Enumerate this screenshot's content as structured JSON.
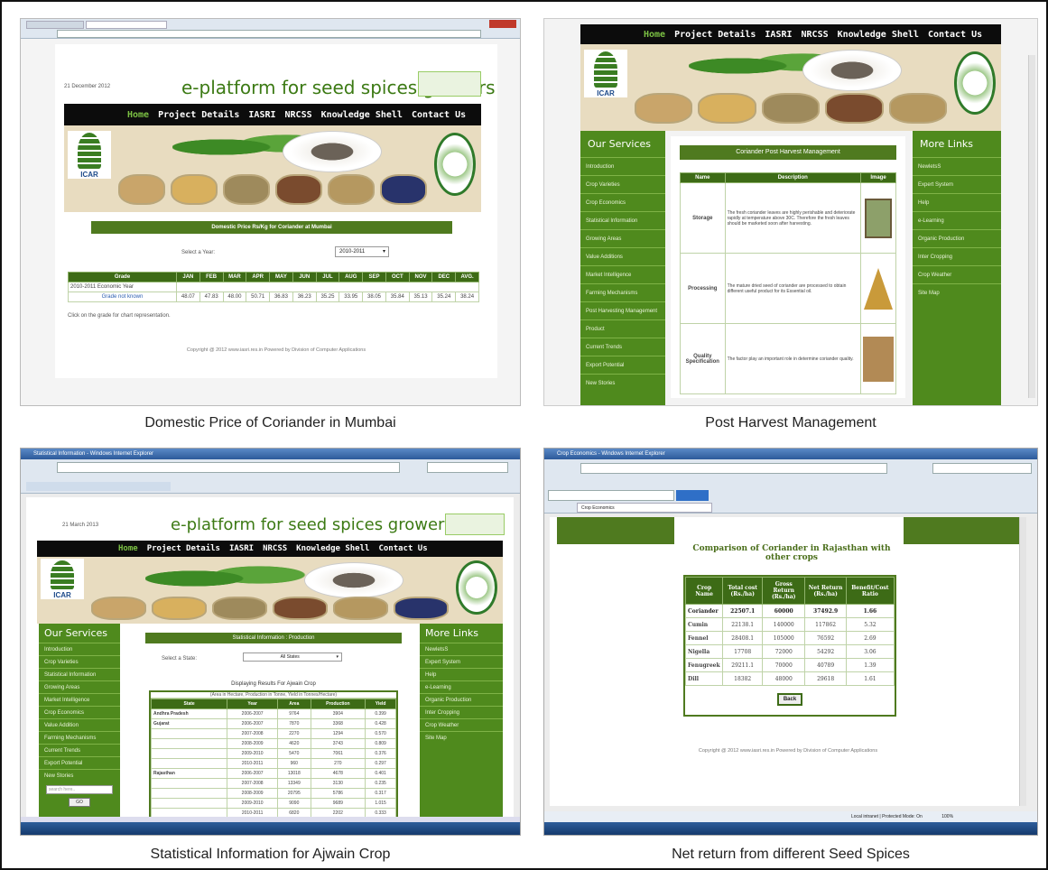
{
  "captions": {
    "q1": "Domestic Price of Coriander in Mumbai",
    "q2": "Post Harvest Management",
    "q3": "Statistical Information for Ajwain Crop",
    "q4": "Net return from different Seed Spices"
  },
  "site": {
    "title": "e-platform for seed spices growers",
    "nav": [
      "Home",
      "Project Details",
      "IASRI",
      "NRCSS",
      "Knowledge Shell",
      "Contact Us"
    ],
    "icar_logo_text": "ICAR",
    "copyright": "Copyright @ 2012 www.iasri.res.in Powered by Division of Computer Applications"
  },
  "q1": {
    "date": "21 December 2012",
    "price_heading": "Domestic Price Rs/Kg for Coriander at Mumbai",
    "select_label": "Select a Year:",
    "select_value": "2010-2011",
    "table_headers": [
      "Grade",
      "JAN",
      "FEB",
      "MAR",
      "APR",
      "MAY",
      "JUN",
      "JUL",
      "AUG",
      "SEP",
      "OCT",
      "NOV",
      "DEC",
      "AVG."
    ],
    "row_year": "2010-2011 Economic Year",
    "row_grade": "Grade not known",
    "row_values": [
      "48.07",
      "47.83",
      "48.00",
      "50.71",
      "36.83",
      "36.23",
      "35.25",
      "33.95",
      "38.05",
      "35.84",
      "35.13",
      "35.24",
      "38.24"
    ],
    "note": "Click on the grade for chart representation."
  },
  "q2": {
    "services_head": "Our Services",
    "services": [
      "Introduction",
      "Crop Varieties",
      "Crop Economics",
      "Statistical Information",
      "Growing Areas",
      "Value Additions",
      "Market Intelligence",
      "Farming Mechanisms",
      "Post Harvesting Management",
      "Product",
      "Current Trends",
      "Export Potential",
      "New Stories"
    ],
    "links_head": "More Links",
    "links": [
      "NewletsS",
      "Expert System",
      "Help",
      "e-Learning",
      "Organic Production",
      "Inter Cropping",
      "Crop Weather",
      "Site Map"
    ],
    "heading": "Coriander Post Harvest Management",
    "cols": [
      "Name",
      "Description",
      "Image"
    ],
    "rows": [
      {
        "name": "Storage",
        "desc": "The fresh coriander leaves are highly perishable and deteriorate rapidly at temperature above 30C. Therefore the fresh leaves should be marketed soon after harvesting."
      },
      {
        "name": "Processing",
        "desc": "The mature dried seed of coriander are processed to obtain different useful product for its Essential oil."
      },
      {
        "name": "Quality Specification",
        "desc": "The factor play an important role in determine coriander quality."
      }
    ]
  },
  "q3": {
    "window_title": "Statistical Information - Windows Internet Explorer",
    "date": "21 March 2013",
    "services_head": "Our Services",
    "services": [
      "Introduction",
      "Crop Varieties",
      "Statistical Information",
      "Growing Areas",
      "Market Intelligence",
      "Crop Economics",
      "Value Addition",
      "Farming Mechanisms",
      "Current Trends",
      "Export Potential",
      "New Stories"
    ],
    "links_head": "More Links",
    "links": [
      "NewletsS",
      "Expert System",
      "Help",
      "e-Learning",
      "Organic Production",
      "Inter Cropping",
      "Crop Weather",
      "Site Map"
    ],
    "heading": "Statistical Information : Production",
    "select_label": "Select a State:",
    "select_value": "All States",
    "results_title": "Displaying Results For Ajwain Crop",
    "units": "(Area in Hectare, Production in Tonne, Yield in Tonnes/Hectare)",
    "cols": [
      "State",
      "Year",
      "Area",
      "Production",
      "Yield"
    ],
    "rows": [
      [
        "Andhra Pradesh",
        "2006-2007",
        "9764",
        "3904",
        "0.399"
      ],
      [
        "Gujarat",
        "2006-2007",
        "7870",
        "3368",
        "0.428"
      ],
      [
        "",
        "2007-2008",
        "2270",
        "1294",
        "0.570"
      ],
      [
        "",
        "2008-2009",
        "4620",
        "3743",
        "0.809"
      ],
      [
        "",
        "2009-2010",
        "5470",
        "7061",
        "0.376"
      ],
      [
        "",
        "2010-2011",
        "960",
        "270",
        "0.297"
      ],
      [
        "Rajasthan",
        "2006-2007",
        "13018",
        "4678",
        "0.401"
      ],
      [
        "",
        "2007-2008",
        "13349",
        "3130",
        "0.235"
      ],
      [
        "",
        "2008-2009",
        "20795",
        "5786",
        "0.317"
      ],
      [
        "",
        "2009-2010",
        "9090",
        "9689",
        "1.015"
      ],
      [
        "",
        "2010-2011",
        "6820",
        "2202",
        "0.333"
      ]
    ],
    "search_placeholder": "search here..",
    "go_button": "GO"
  },
  "q4": {
    "window_title": "Crop Economics - Windows Internet Explorer",
    "tab": "Crop Economics",
    "heading": "Comparison of Coriander in Rajasthan with other crops",
    "cols": [
      "Crop Name",
      "Total cost (Rs./ha)",
      "Gross Return (Rs./ha)",
      "Net Return (Rs./ha)",
      "Benefit/Cost Ratio"
    ],
    "rows": [
      [
        "Coriander",
        "22507.1",
        "60000",
        "37492.9",
        "1.66"
      ],
      [
        "Cumin",
        "22138.1",
        "140000",
        "117862",
        "5.32"
      ],
      [
        "Fennel",
        "28408.1",
        "105000",
        "76592",
        "2.69"
      ],
      [
        "Nigella",
        "17708",
        "72000",
        "54292",
        "3.06"
      ],
      [
        "Fenugreek",
        "29211.1",
        "70000",
        "40789",
        "1.39"
      ],
      [
        "Dill",
        "18382",
        "48000",
        "29618",
        "1.61"
      ]
    ],
    "back": "Back",
    "status": "Local intranet | Protected Mode: On",
    "zoom": "100%"
  }
}
